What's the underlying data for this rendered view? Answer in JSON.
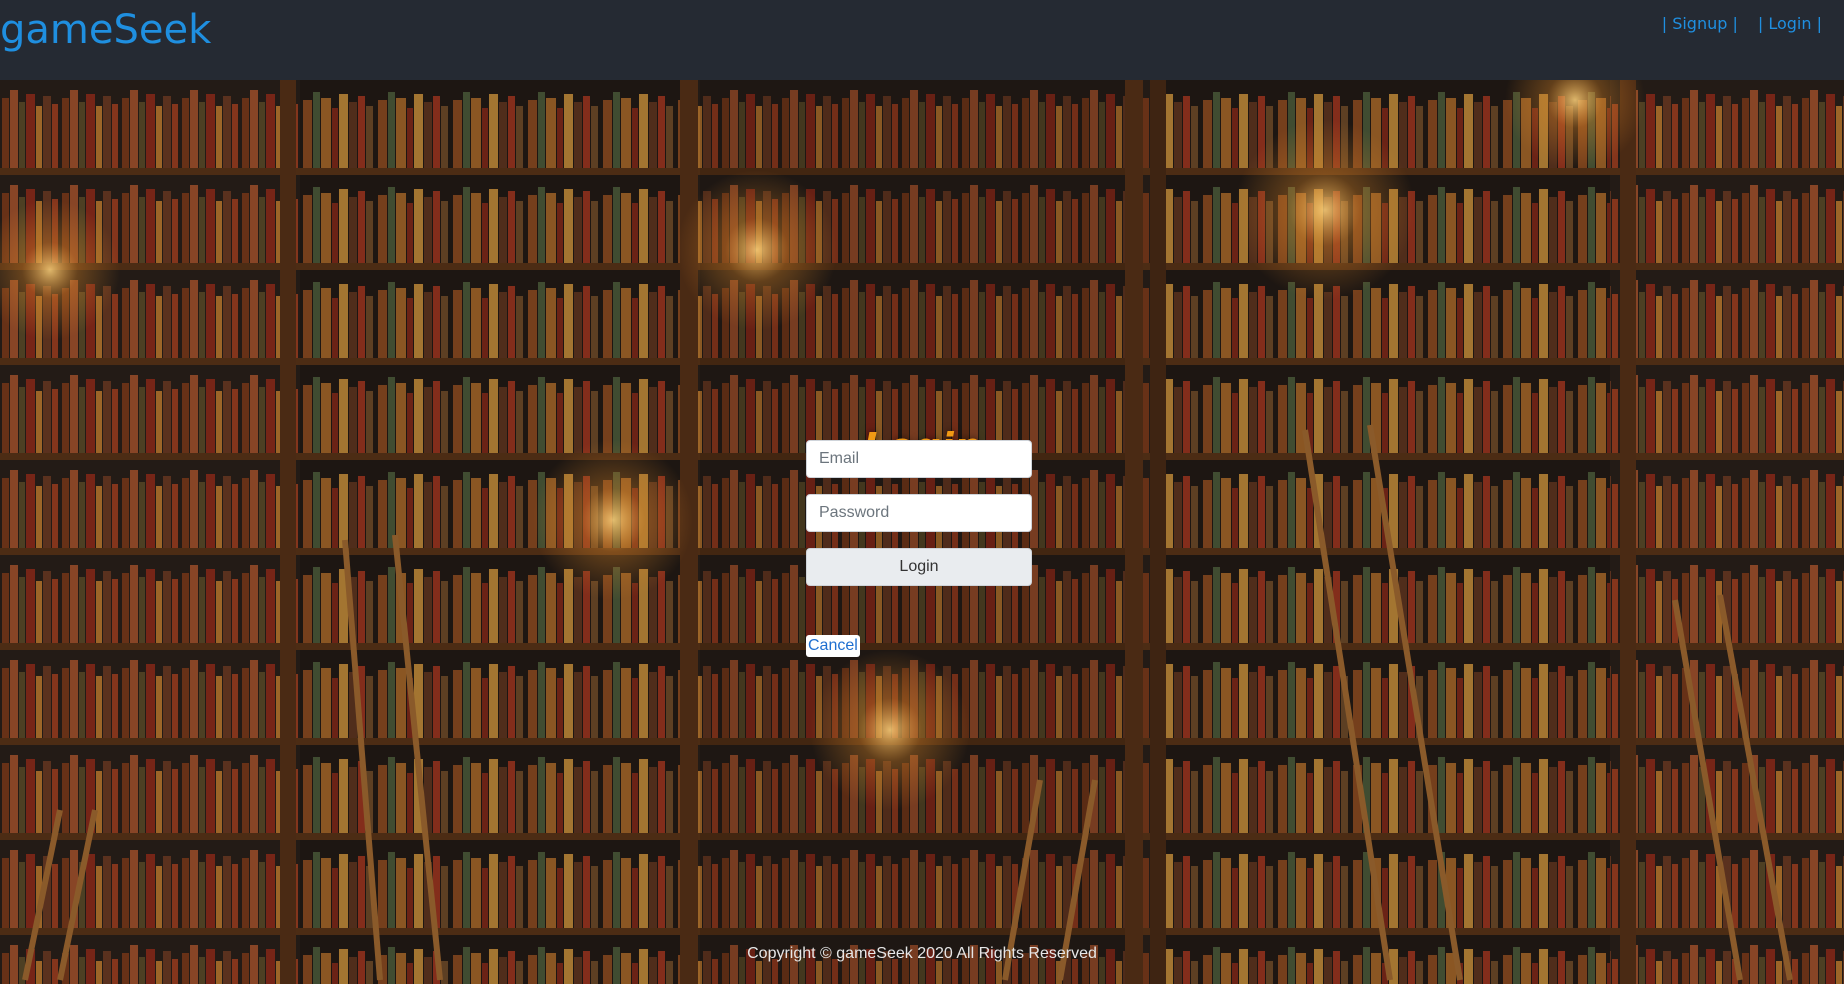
{
  "navbar": {
    "brand": "gameSeek",
    "links": [
      {
        "label": "| Signup |"
      },
      {
        "label": "| Login |"
      }
    ]
  },
  "login_form": {
    "title": "Login",
    "email_placeholder": "Email",
    "password_placeholder": "Password",
    "submit_label": "Login",
    "cancel_label": "Cancel"
  },
  "footer": {
    "copyright": "Copyright © gameSeek 2020 All Rights Reserved"
  },
  "colors": {
    "navbar_bg": "#252a33",
    "brand": "#1f8fe0",
    "title": "#f29a14",
    "background_image": "library-bookshelves"
  }
}
